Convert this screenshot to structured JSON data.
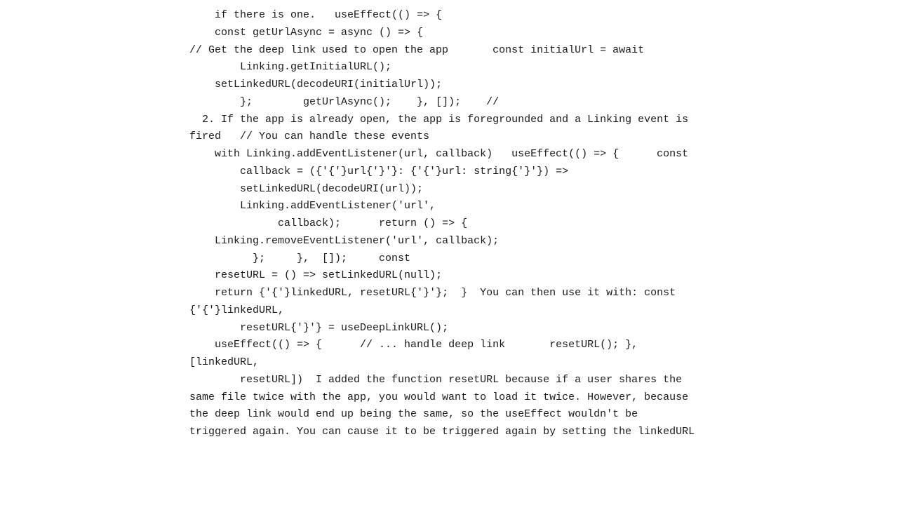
{
  "content": {
    "lines": [
      "    if there is one.   useEffect(() => {",
      "    const getUrlAsync = async () => {",
      "// Get the deep link used to open the app       const initialUrl = await",
      "        Linking.getInitialURL();",
      "    setLinkedURL(decodeURI(initialUrl));",
      "        };        getUrlAsync();    }, []);    //",
      "  2. If the app is already open, the app is foregrounded and a Linking event is fired   // You can handle these events",
      "    with Linking.addEventListener(url, callback)   useEffect(() => {      const",
      "        callback = ({url}: {url: string}) =>",
      "        setLinkedURL(decodeURI(url));",
      "        Linking.addEventListener('url',",
      "              callback);      return () => {",
      "    Linking.removeEventListener('url', callback);",
      "          };     },  []);     const",
      "    resetURL = () => setLinkedURL(null);",
      "    return {linkedURL, resetURL}; }  You can then use it with: const {linkedURL,",
      "        resetURL} = useDeepLinkURL();",
      "    useEffect(() => {      // ... handle deep link       resetURL(); }, [linkedURL,",
      "        resetURL])  I added the function resetURL because if a user shares the same file twice with the app, you would want to load it twice. However, because the deep link would end up being the same, so the useEffect wouldn't be triggered again. You can cause it to be triggered again by setting the linkedURL"
    ]
  }
}
